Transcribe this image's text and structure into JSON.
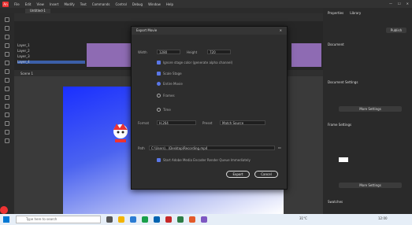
{
  "menubar": {
    "app_label": "An",
    "items": [
      "File",
      "Edit",
      "View",
      "Insert",
      "Modify",
      "Text",
      "Commands",
      "Control",
      "Debug",
      "Window",
      "Help"
    ]
  },
  "tabs": [
    "Untitled-1"
  ],
  "timeline": {
    "layers": [
      "Layer_1",
      "Layer_2",
      "Layer_3",
      "Layer_4"
    ],
    "scene_label": "Scene 1"
  },
  "right_panel": {
    "tabs": [
      "Properties",
      "Library"
    ],
    "top_button": "Publish",
    "sections": [
      "Document",
      "Document Settings",
      "Frame Settings",
      "Swatches"
    ],
    "buttons": [
      "More Settings",
      "More Settings"
    ]
  },
  "dialog": {
    "title": "Export Movie",
    "rows": {
      "width_label": "Width",
      "width_value": "1280",
      "height_label": "Height",
      "height_value": "720",
      "option1": "Ignore stage color (generate alpha channel)",
      "option2": "Scale Stage",
      "radio1": "Entire Movie",
      "radio2": "Frames",
      "radio3": "Time",
      "format_label": "Format",
      "format_value": "H.264",
      "preset_label": "Preset",
      "preset_value": "Match Source",
      "path_label": "Path",
      "path_value": "C:\\Users\\...\\Desktop\\Recording.mp4",
      "open_after": "Start Adobe Media Encoder Render Queue Immediately"
    },
    "export_button": "Export",
    "cancel_button": "Cancel"
  },
  "taskbar": {
    "search_placeholder": "Type here to search",
    "temperature": "31°C",
    "time": "12:00"
  },
  "colors": {
    "accent": "#5a77e8",
    "frames": "#8e6bb3",
    "stage_top": "#1a2fff"
  }
}
